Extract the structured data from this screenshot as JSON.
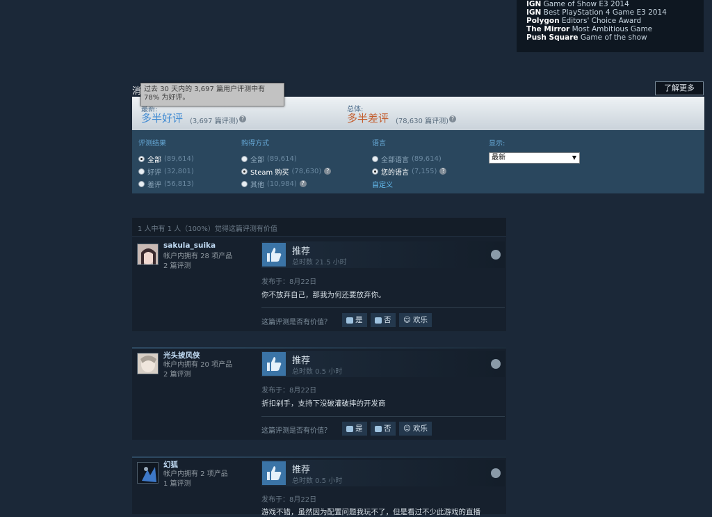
{
  "awards": [
    {
      "source": "IGN",
      "text": "Game of Show E3 2014"
    },
    {
      "source": "IGN",
      "text": "Best PlayStation 4 Game E3 2014"
    },
    {
      "source": "Polygon",
      "text": "Editors' Choice Award"
    },
    {
      "source": "The Mirror",
      "text": "Most Ambitious Game"
    },
    {
      "source": "Push Square",
      "text": "Game of the show"
    }
  ],
  "reviews_header": {
    "title_stub": "消",
    "learn_more": "了解更多",
    "tooltip": "过去 30 天内的 3,697 篇用户评测中有 78% 为好评。"
  },
  "summary": {
    "recent_label": "最新:",
    "recent_rating": "多半好评",
    "recent_count": "(3,697 篇评测)",
    "overall_label": "总体:",
    "overall_rating": "多半差评",
    "overall_count": "(78,630 篇评测)",
    "colors": {
      "positive": "#66c0f4",
      "negative": "#c35c2c"
    }
  },
  "filters": {
    "result": {
      "header": "评测结果",
      "options": [
        {
          "label": "全部",
          "count": "(89,614)",
          "selected": true
        },
        {
          "label": "好评",
          "count": "(32,801)",
          "selected": false
        },
        {
          "label": "差评",
          "count": "(56,813)",
          "selected": false
        }
      ]
    },
    "purchase": {
      "header": "购得方式",
      "options": [
        {
          "label": "全部",
          "count": "(89,614)",
          "selected": false
        },
        {
          "label": "Steam 购买",
          "count": "(78,630)",
          "selected": true
        },
        {
          "label": "其他",
          "count": "(10,984)",
          "selected": false
        }
      ]
    },
    "language": {
      "header": "语言",
      "options": [
        {
          "label": "全部语言",
          "count": "(89,614)",
          "selected": false
        },
        {
          "label": "您的语言",
          "count": "(7,155)",
          "selected": true
        }
      ],
      "custom": "自定义"
    },
    "display": {
      "header": "显示:",
      "value": "最新"
    }
  },
  "reviews": [
    {
      "helpful_top": "1 人中有 1 人（100%）觉得这篇评测有价值",
      "user": "sakula_suika",
      "products": "帐户内拥有 28 项产品",
      "review_count": "2 篇评测",
      "verdict": "推荐",
      "hours": "总时数 21.5 小时",
      "posted": "发布于：8月22日",
      "text": "你不放弃自己，那我为何还要放弃你。",
      "vote_question": "这篇评测是否有价值？",
      "yes": "是",
      "no": "否",
      "funny": "欢乐"
    },
    {
      "user": "光头披风侠",
      "products": "帐户内拥有 20 项产品",
      "review_count": "2 篇评测",
      "verdict": "推荐",
      "hours": "总时数 0.5 小时",
      "posted": "发布于：8月22日",
      "text": "折扣剁手，支持下没破灌破摔的开发商",
      "vote_question": "这篇评测是否有价值？",
      "yes": "是",
      "no": "否",
      "funny": "欢乐"
    },
    {
      "user": "幻狐",
      "products": "帐户内拥有 2 项产品",
      "review_count": "1 篇评测",
      "verdict": "推荐",
      "hours": "总时数 0.5 小时",
      "posted": "发布于：8月22日",
      "text": "游戏不错，虽然因为配置问题我玩不了，但是看过不少此游戏的直播"
    }
  ]
}
